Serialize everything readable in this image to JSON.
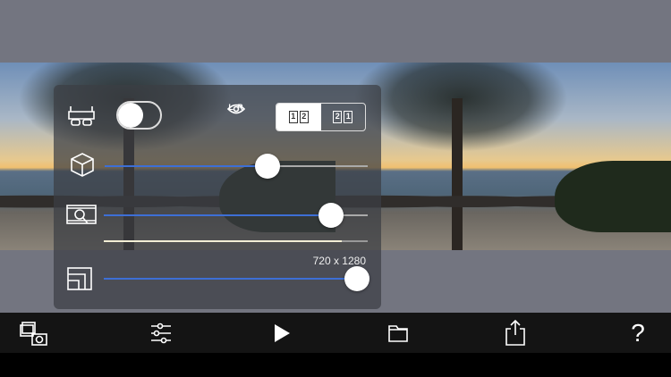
{
  "toolbar_top": {
    "stereo_toggle": {
      "on": false
    },
    "eye_label": "L R",
    "order_options": [
      "1",
      "2",
      "2",
      "1"
    ],
    "order_selected": "12"
  },
  "sliders": {
    "depth": 0.62,
    "zoom": 0.86,
    "playback_progress": 0.9,
    "resolution": 0.96
  },
  "resolution_label": "720 x 1280",
  "bottom_toolbar": [
    "gallery-camera",
    "adjustments",
    "play",
    "folder",
    "share",
    "help"
  ],
  "help_label": "?",
  "colors": {
    "accent": "#3d6fd6",
    "background": "#737580",
    "toolbar": "#141414"
  }
}
